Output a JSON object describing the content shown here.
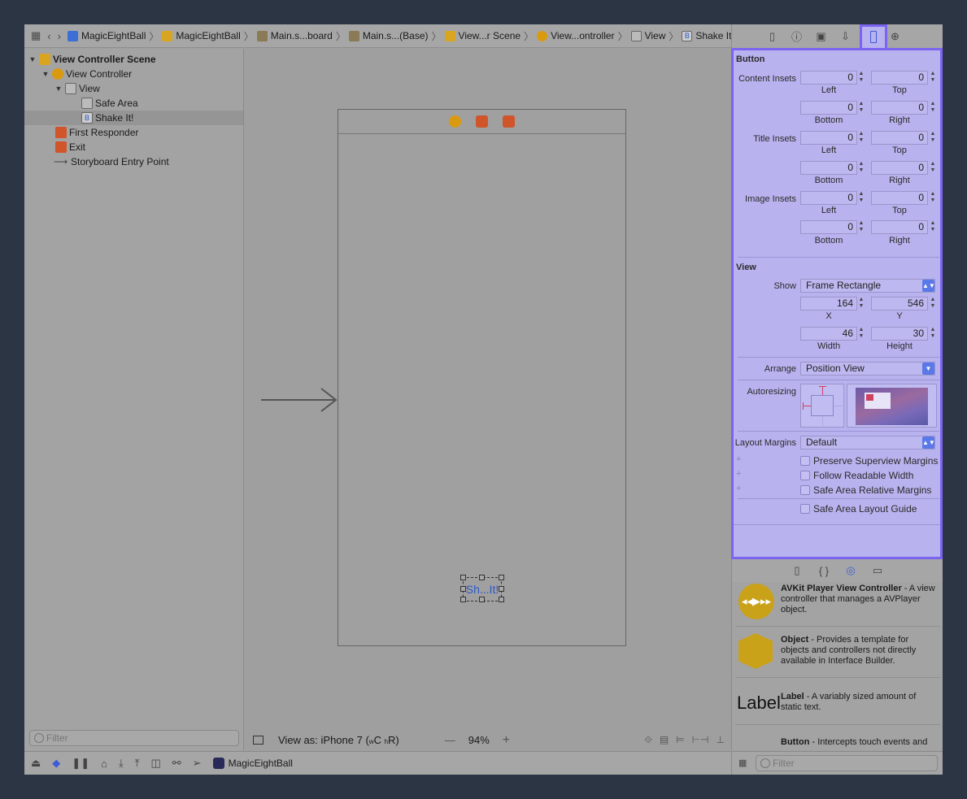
{
  "breadcrumb": [
    {
      "label": "MagicEightBall",
      "icon": "project-icon"
    },
    {
      "label": "MagicEightBall",
      "icon": "folder-icon"
    },
    {
      "label": "Main.s...board",
      "icon": "storyboard-icon"
    },
    {
      "label": "Main.s...(Base)",
      "icon": "storyboard-icon"
    },
    {
      "label": "View...r Scene",
      "icon": "scene-icon"
    },
    {
      "label": "View...ontroller",
      "icon": "view-controller-icon"
    },
    {
      "label": "View",
      "icon": "view-icon"
    },
    {
      "label": "Shake It!",
      "icon": "button-icon"
    }
  ],
  "navigator": {
    "items": [
      {
        "label": "View Controller Scene"
      },
      {
        "label": "View Controller"
      },
      {
        "label": "View"
      },
      {
        "label": "Safe Area"
      },
      {
        "label": "Shake It!"
      },
      {
        "label": "First Responder"
      },
      {
        "label": "Exit"
      },
      {
        "label": "Storyboard Entry Point"
      }
    ],
    "filter_placeholder": "Filter"
  },
  "canvas": {
    "button_text": "Sh...It!",
    "view_as": "View as: iPhone 7 (",
    "view_as_w": "w",
    "view_as_c": "C",
    "view_as_h": "h",
    "view_as_r": "R)",
    "zoom_minus": "—",
    "zoom": "94%",
    "zoom_plus": "+"
  },
  "bottom_bar": {
    "scheme": "MagicEightBall"
  },
  "inspector": {
    "button_section": "Button",
    "content_insets": {
      "label": "Content Insets",
      "left": "0",
      "top": "0",
      "bottom": "0",
      "right": "0"
    },
    "title_insets": {
      "label": "Title Insets",
      "left": "0",
      "top": "0",
      "bottom": "0",
      "right": "0"
    },
    "image_insets": {
      "label": "Image Insets",
      "left": "0",
      "top": "0",
      "bottom": "0",
      "right": "0"
    },
    "sub_left": "Left",
    "sub_top": "Top",
    "sub_bottom": "Bottom",
    "sub_right": "Right",
    "view_section": "View",
    "show_label": "Show",
    "show_value": "Frame Rectangle",
    "x": "164",
    "y": "546",
    "width": "46",
    "height": "30",
    "sub_x": "X",
    "sub_y": "Y",
    "sub_width": "Width",
    "sub_height": "Height",
    "arrange_label": "Arrange",
    "arrange_value": "Position View",
    "autoresizing_label": "Autoresizing",
    "layout_margins_label": "Layout Margins",
    "layout_margins_value": "Default",
    "checkboxes": [
      {
        "label": "Preserve Superview Margins",
        "checked": false
      },
      {
        "label": "Follow Readable Width",
        "checked": false
      },
      {
        "label": "Safe Area Relative Margins",
        "checked": false
      },
      {
        "label": "Safe Area Layout Guide",
        "checked": false
      }
    ],
    "highlight_color": "#7a64f0"
  },
  "library": {
    "items": [
      {
        "name": "AVKit Player View Controller",
        "desc": " - A view controller that manages a AVPlayer object."
      },
      {
        "name": "Object",
        "desc": " - Provides a template for objects and controllers not directly available in Interface Builder."
      },
      {
        "name": "Label",
        "desc": " - A variably sized amount of static text.",
        "preview": "Label"
      },
      {
        "name": "Button",
        "desc": " - Intercepts touch events and"
      }
    ],
    "filter_placeholder": "Filter"
  }
}
